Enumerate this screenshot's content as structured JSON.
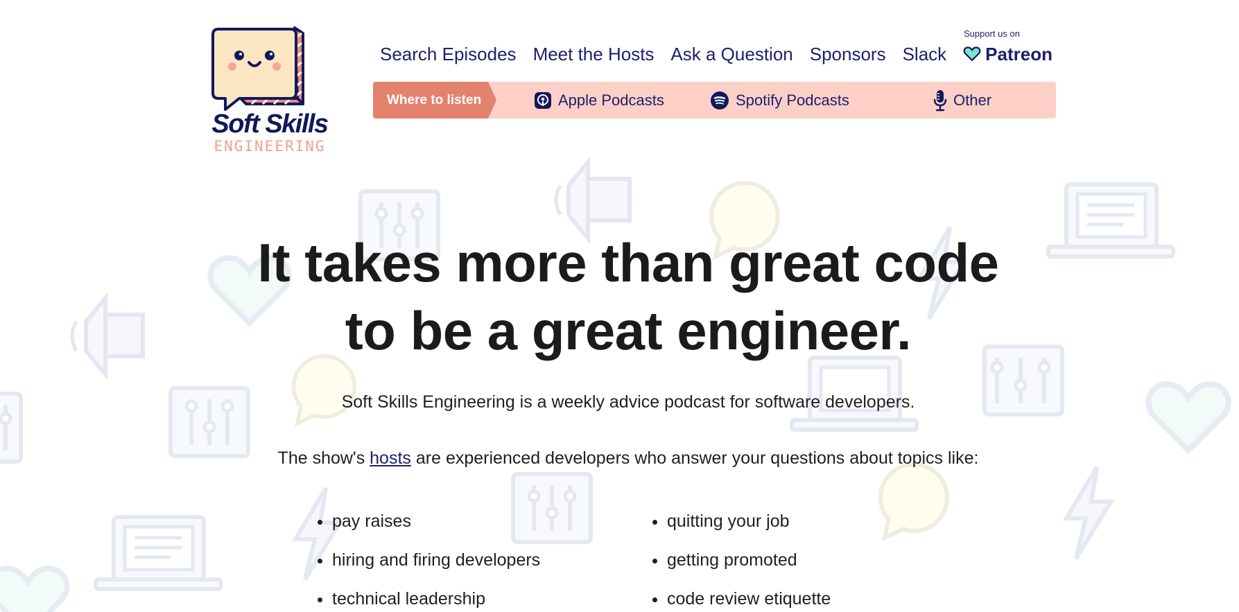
{
  "brand": {
    "name_line1": "Soft Skills",
    "name_line2": "ENGINEERING",
    "colors": {
      "navy": "#12185a",
      "coral": "#e3826d",
      "peach": "#fdd0c7",
      "logo_face": "#fbe6c4",
      "salmon_text": "#f4a08a"
    }
  },
  "nav": {
    "items": [
      {
        "label": "Search Episodes"
      },
      {
        "label": "Meet the Hosts"
      },
      {
        "label": "Ask a Question"
      },
      {
        "label": "Sponsors"
      },
      {
        "label": "Slack"
      }
    ],
    "support_label": "Support us on",
    "patreon": {
      "label": "Patreon",
      "icon": "heart-icon"
    }
  },
  "listen": {
    "tab_label": "Where to listen",
    "platforms": [
      {
        "label": "Apple Podcasts",
        "icon": "apple-podcasts-icon"
      },
      {
        "label": "Spotify Podcasts",
        "icon": "spotify-icon"
      },
      {
        "label": "Other",
        "icon": "microphone-icon"
      }
    ]
  },
  "hero": {
    "title_line1": "It takes more than great code",
    "title_line2": "to be a great engineer.",
    "intro": "Soft Skills Engineering is a weekly advice podcast for software developers.",
    "topics_intro_before": "The show's ",
    "topics_intro_link": "hosts",
    "topics_intro_after": " are experienced developers who answer your questions about topics like:"
  },
  "topics": {
    "left": [
      "pay raises",
      "hiring and firing developers",
      "technical leadership"
    ],
    "right": [
      "quitting your job",
      "getting promoted",
      "code review etiquette"
    ]
  }
}
